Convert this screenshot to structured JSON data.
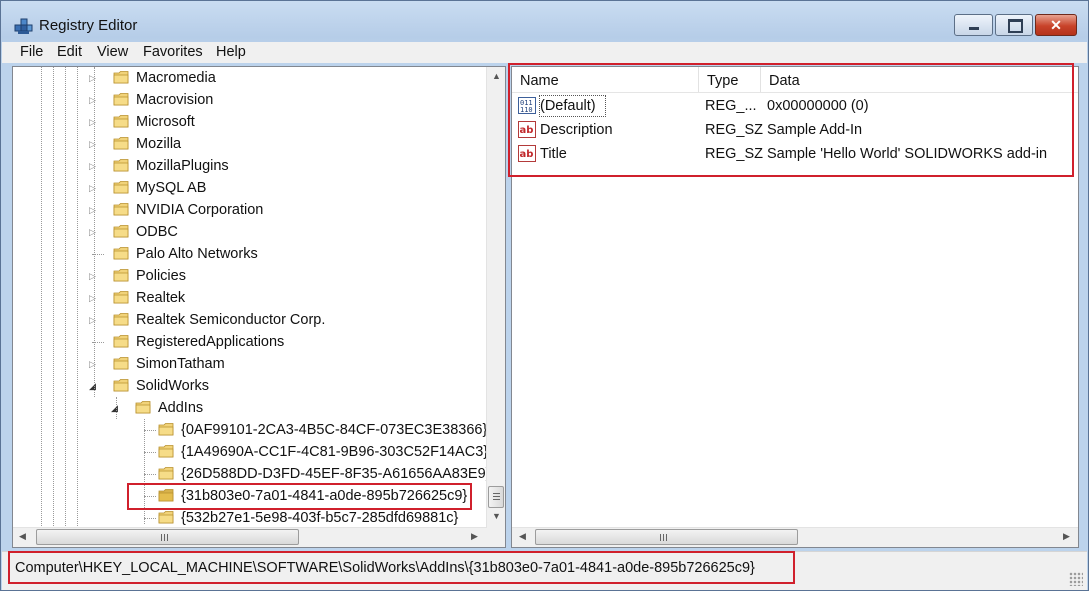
{
  "window": {
    "title": "Registry Editor",
    "close_glyph": "✕"
  },
  "menu": [
    "File",
    "Edit",
    "View",
    "Favorites",
    "Help"
  ],
  "tree": {
    "items": [
      {
        "label": "Macromedia",
        "expander": "collapsed"
      },
      {
        "label": "Macrovision",
        "expander": "collapsed"
      },
      {
        "label": "Microsoft",
        "expander": "collapsed"
      },
      {
        "label": "Mozilla",
        "expander": "collapsed"
      },
      {
        "label": "MozillaPlugins",
        "expander": "collapsed"
      },
      {
        "label": "MySQL AB",
        "expander": "collapsed"
      },
      {
        "label": "NVIDIA Corporation",
        "expander": "collapsed"
      },
      {
        "label": "ODBC",
        "expander": "collapsed"
      },
      {
        "label": "Palo Alto Networks",
        "expander": "none"
      },
      {
        "label": "Policies",
        "expander": "collapsed"
      },
      {
        "label": "Realtek",
        "expander": "collapsed"
      },
      {
        "label": "Realtek Semiconductor Corp.",
        "expander": "collapsed"
      },
      {
        "label": "RegisteredApplications",
        "expander": "none"
      },
      {
        "label": "SimonTatham",
        "expander": "collapsed"
      },
      {
        "label": "SolidWorks",
        "expander": "expanded"
      },
      {
        "label": "AddIns",
        "expander": "expanded"
      },
      {
        "label": "{0AF99101-2CA3-4B5C-84CF-073EC3E38366}",
        "expander": "none"
      },
      {
        "label": "{1A49690A-CC1F-4C81-9B96-303C52F14AC3}",
        "expander": "none"
      },
      {
        "label": "{26D588DD-D3FD-45EF-8F35-A61656AA83E9}",
        "expander": "none"
      },
      {
        "label": "{31b803e0-7a01-4841-a0de-895b726625c9}",
        "expander": "none",
        "selected": true
      },
      {
        "label": "{532b27e1-5e98-403f-b5c7-285dfd69881c}",
        "expander": "none"
      }
    ]
  },
  "values_pane": {
    "columns": {
      "name": "Name",
      "type": "Type",
      "data": "Data"
    },
    "rows": [
      {
        "icon": "binary-value-icon",
        "name": "(Default)",
        "type": "REG_...",
        "data": "0x00000000 (0)"
      },
      {
        "icon": "string-value-icon",
        "name": "Description",
        "type": "REG_SZ",
        "data": "Sample Add-In"
      },
      {
        "icon": "string-value-icon",
        "name": "Title",
        "type": "REG_SZ",
        "data": "Sample 'Hello World' SOLIDWORKS add-in"
      }
    ]
  },
  "status": {
    "path": "Computer\\HKEY_LOCAL_MACHINE\\SOFTWARE\\SolidWorks\\AddIns\\{31b803e0-7a01-4841-a0de-895b726625c9}"
  },
  "colors": {
    "highlight": "#d0202c",
    "folder": "#e8c35a"
  }
}
